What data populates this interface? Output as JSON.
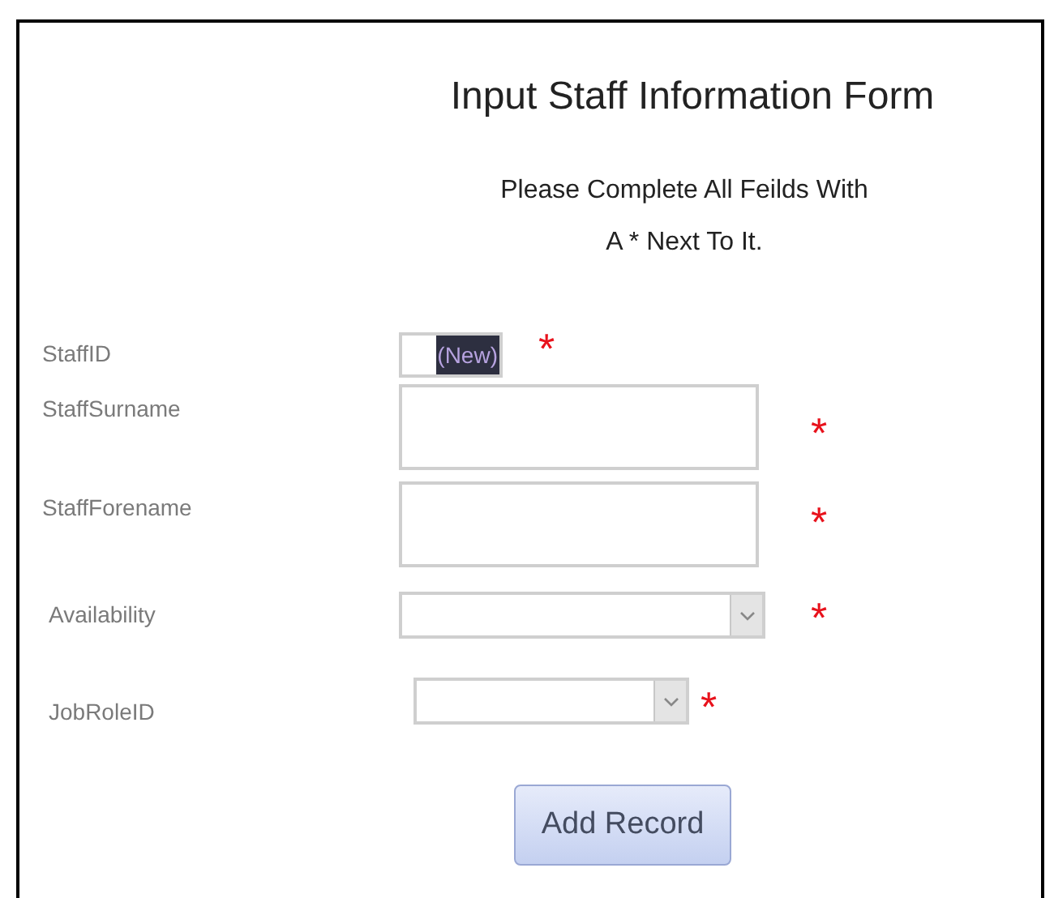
{
  "title": "Input Staff Information Form",
  "instructions": [
    "Please Complete All Feilds With",
    "A * Next To It."
  ],
  "fields": [
    {
      "label": "StaffID",
      "kind": "id",
      "value": "(New)",
      "selected": true,
      "marker": "*"
    },
    {
      "label": "StaffSurname",
      "kind": "text",
      "marker": "*"
    },
    {
      "label": "StaffForename",
      "kind": "text",
      "marker": "*"
    },
    {
      "label": "Availability",
      "kind": "combo",
      "marker": "*"
    },
    {
      "label": "JobRoleID",
      "kind": "combo",
      "marker": "*"
    }
  ],
  "button": "Add Record"
}
